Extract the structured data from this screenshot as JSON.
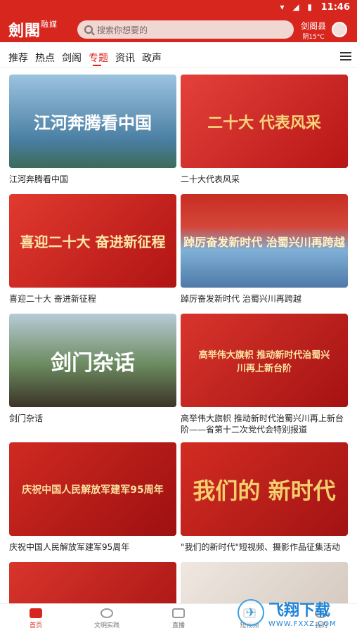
{
  "status": {
    "time": "11:46",
    "icons": "▾ ◢ ▮"
  },
  "header": {
    "logo": "劍閣",
    "logo_tag": "融媒",
    "search_placeholder": "搜索你想要的",
    "city": "剑阁县",
    "weather": "阴15°C"
  },
  "tabs": [
    "推荐",
    "热点",
    "剑阁",
    "专题",
    "资讯",
    "政声"
  ],
  "active_tab": "专题",
  "cards": [
    {
      "thumb_text": "江河奔腾看中国",
      "caption": "江河奔腾看中国",
      "bg": "#4a7fa3"
    },
    {
      "thumb_text": "二十大 代表风采",
      "caption": "二十大代表风采",
      "bg": "#c81e1e"
    },
    {
      "thumb_text": "喜迎二十大 奋进新征程",
      "caption": "喜迎二十大 奋进新征程",
      "bg": "#d3201d"
    },
    {
      "thumb_text": "踔厉奋发新时代 治蜀兴川再跨越",
      "caption": "踔厉奋发新时代 治蜀兴川再跨越",
      "bg": "#5a8bb9"
    },
    {
      "thumb_text": "剑门杂话",
      "caption": "剑门杂话",
      "bg": "#4c6e4a"
    },
    {
      "thumb_text": "高举伟大旗帜 推动新时代治蜀兴川再上新台阶",
      "caption": "高举伟大旗帜 推动新时代治蜀兴川再上新台阶——省第十二次党代会特别报道",
      "bg": "#c41d1d"
    },
    {
      "thumb_text": "庆祝中国人民解放军建军95周年",
      "caption": "庆祝中国人民解放军建军95周年",
      "bg": "#b5171a"
    },
    {
      "thumb_text": "我们的 新时代",
      "caption": "\"我们的新时代\"短视频、摄影作品征集活动",
      "bg": "#c01a1b"
    },
    {
      "thumb_text": "",
      "caption": "",
      "bg": "#c41d1d"
    },
    {
      "thumb_text": "",
      "caption": "",
      "bg": "#e7ddd5"
    }
  ],
  "bottom_nav": [
    "首页",
    "文明实践",
    "直播",
    "短视频",
    "我的"
  ],
  "active_nav": "首页",
  "watermark": {
    "title": "飞翔下载",
    "url": "WWW.FXXZ.COM"
  }
}
